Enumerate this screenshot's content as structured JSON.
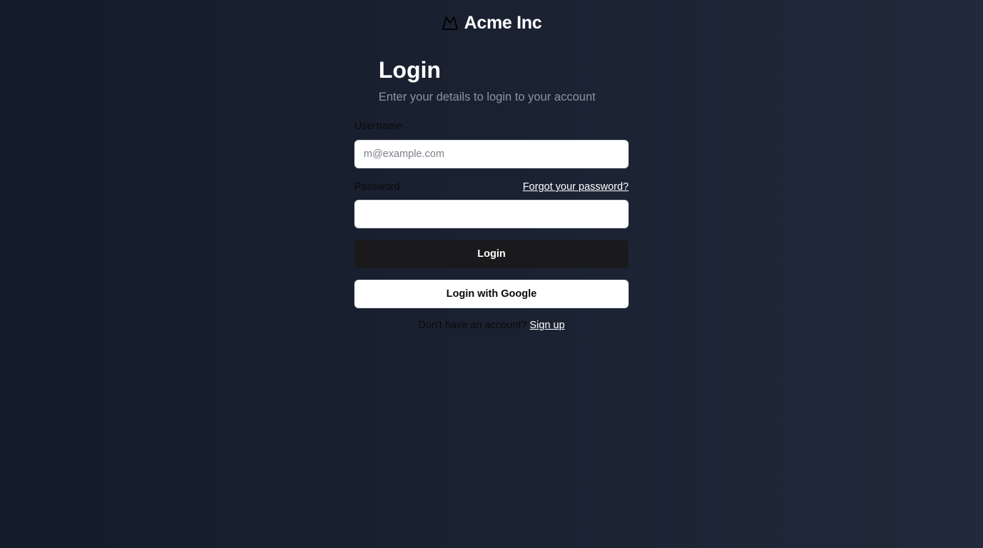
{
  "brand": {
    "name": "Acme Inc",
    "icon": "mountain-icon"
  },
  "header": {
    "title": "Login",
    "subtitle": "Enter your details to login to your account"
  },
  "form": {
    "username_label": "Username",
    "username_placeholder": "m@example.com",
    "username_value": "",
    "password_label": "Password",
    "password_value": "",
    "forgot_link": "Forgot your password?",
    "login_button": "Login",
    "google_button": "Login with Google",
    "signup_prompt": "Don't have an account?",
    "signup_link": "Sign up"
  },
  "colors": {
    "background_start": "#141b2b",
    "background_end": "#212a3a",
    "primary_button": "#1a1a1c",
    "text_white": "#ffffff",
    "text_muted": "#8b93a3"
  }
}
